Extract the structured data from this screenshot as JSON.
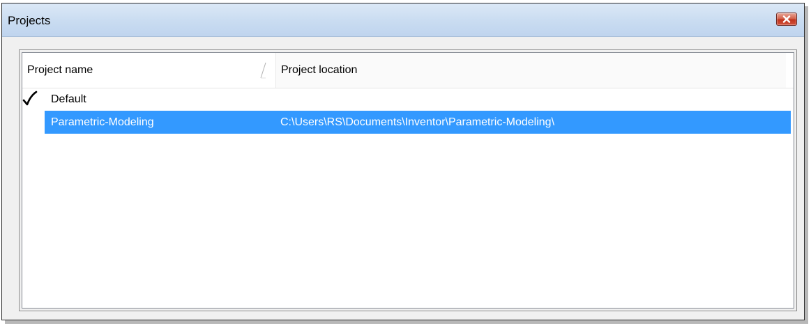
{
  "window": {
    "title": "Projects",
    "close_icon": "close-icon",
    "close_button_color": "#c94430"
  },
  "list": {
    "columns": [
      {
        "label": "Project name",
        "sorted": true
      },
      {
        "label": "Project location",
        "sorted": false
      }
    ],
    "rows": [
      {
        "active": true,
        "selected": false,
        "name": "Default",
        "location": ""
      },
      {
        "active": false,
        "selected": true,
        "name": "Parametric-Modeling",
        "location": "C:\\Users\\RS\\Documents\\Inventor\\Parametric-Modeling\\"
      }
    ],
    "selection_color": "#3399ff",
    "active_marker_icon": "checkmark-icon"
  }
}
